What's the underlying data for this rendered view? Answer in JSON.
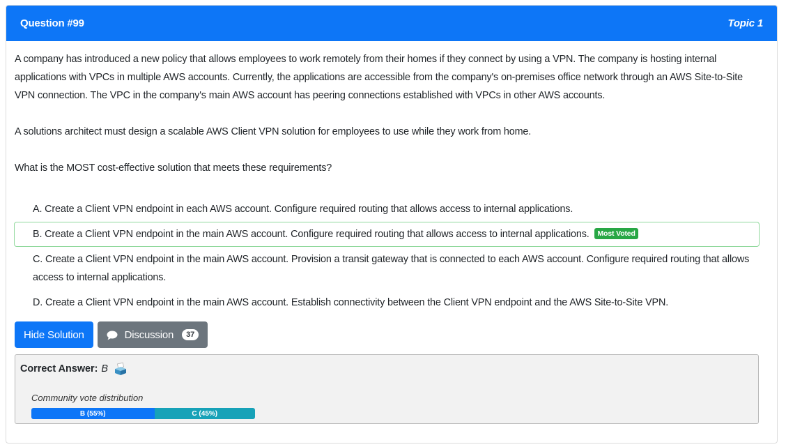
{
  "header": {
    "question_number": "Question #99",
    "topic": "Topic 1"
  },
  "question": {
    "paragraphs": [
      "A company has introduced a new policy that allows employees to work remotely from their homes if they connect by using a VPN. The company is hosting internal applications with VPCs in multiple AWS accounts. Currently, the applications are accessible from the company's on-premises office network through an AWS Site-to-Site VPN connection. The VPC in the company's main AWS account has peering connections established with VPCs in other AWS accounts.",
      "A solutions architect must design a scalable AWS Client VPN solution for employees to use while they work from home.",
      "What is the MOST cost-effective solution that meets these requirements?"
    ]
  },
  "choices": [
    {
      "letter": "A.",
      "text": "Create a Client VPN endpoint in each AWS account. Configure required routing that allows access to internal applications."
    },
    {
      "letter": "B.",
      "text": "Create a Client VPN endpoint in the main AWS account. Configure required routing that allows access to internal applications.",
      "badge": "Most Voted"
    },
    {
      "letter": "C.",
      "text": "Create a Client VPN endpoint in the main AWS account. Provision a transit gateway that is connected to each AWS account. Configure required routing that allows access to internal applications."
    },
    {
      "letter": "D.",
      "text": "Create a Client VPN endpoint in the main AWS account. Establish connectivity between the Client VPN endpoint and the AWS Site-to-Site VPN."
    }
  ],
  "buttons": {
    "hide_solution": "Hide Solution",
    "discussion": "Discussion",
    "discussion_count": "37"
  },
  "answer": {
    "label": "Correct Answer:",
    "value": "B",
    "distribution_label": "Community vote distribution",
    "votes": [
      {
        "label": "B (55%)",
        "percent": 55,
        "color": "#0d76f7"
      },
      {
        "label": "C (45%)",
        "percent": 45,
        "color": "#17a2b8"
      }
    ]
  },
  "colors": {
    "primary": "#0d76f7",
    "secondary": "#6c757d",
    "most_voted": "#28a745",
    "correct_border": "#8fd89b"
  }
}
